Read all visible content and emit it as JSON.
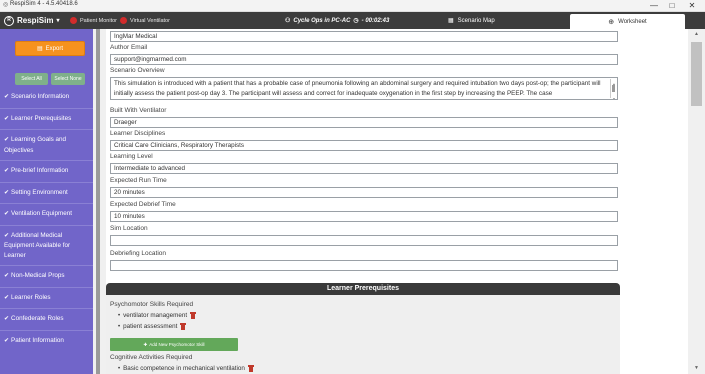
{
  "window": {
    "title": "RespiSim 4 - 4.5.40418.6",
    "minimize": "—",
    "maximize": "□",
    "close": "✕"
  },
  "topbar": {
    "brand": "RespiSim",
    "brand_caret": "▾",
    "patient_monitor": "Patient Monitor",
    "virtual_ventilator": "Virtual Ventilator",
    "cycle": "Cycle Ops in PC-AC",
    "cycle_time": "- 00:02:43",
    "scenario_map": "Scenario Map",
    "worksheet": "Worksheet"
  },
  "sidebar": {
    "export_label": "Export",
    "select_all": "Select All",
    "select_none": "Select None",
    "items": [
      {
        "label": "Scenario Information"
      },
      {
        "label": "Learner Prerequisites"
      },
      {
        "label": "Learning Goals and Objectives"
      },
      {
        "label": "Pre-brief Information"
      },
      {
        "label": "Setting Environment"
      },
      {
        "label": "Ventilation Equipment"
      },
      {
        "label": "Additional Medical Equipment Available for Learner"
      },
      {
        "label": "Non-Medical Props"
      },
      {
        "label": "Learner Roles"
      },
      {
        "label": "Confederate Roles"
      },
      {
        "label": "Patient Information"
      }
    ]
  },
  "form": {
    "top_value": "IngMar Medical",
    "author_email_label": "Author Email",
    "author_email_value": "support@ingmarmed.com",
    "scenario_overview_label": "Scenario Overview",
    "scenario_overview_value": "This simulation is introduced with a patient that has a probable case of pneumonia following an abdominal surgery and required intubation two days post-op; the participant will initially assess the patient post-op day 3. The participant will assess and correct for inadequate oxygenation in the first step by increasing the PEEP. The case",
    "built_with_label": "Built With Ventilator",
    "built_with_value": "Draeger",
    "disciplines_label": "Learner Disciplines",
    "disciplines_value": "Critical Care Clinicians, Respiratory Therapists",
    "learning_level_label": "Learning Level",
    "learning_level_value": "Intermediate to advanced",
    "run_time_label": "Expected Run Time",
    "run_time_value": "20 minutes",
    "debrief_time_label": "Expected Debrief Time",
    "debrief_time_value": "10 minutes",
    "sim_location_label": "Sim Location",
    "sim_location_value": "",
    "debriefing_location_label": "Debriefing Location",
    "debriefing_location_value": ""
  },
  "prereq": {
    "header": "Learner Prerequisites",
    "psychomotor_label": "Psychomotor Skills Required",
    "psychomotor_items": [
      "ventilator management",
      "patient assessment"
    ],
    "add_skill": "Add New Psychomotor Skill",
    "cognitive_label": "Cognitive Activities Required",
    "cognitive_items": [
      "Basic competence in mechanical ventilation"
    ]
  }
}
